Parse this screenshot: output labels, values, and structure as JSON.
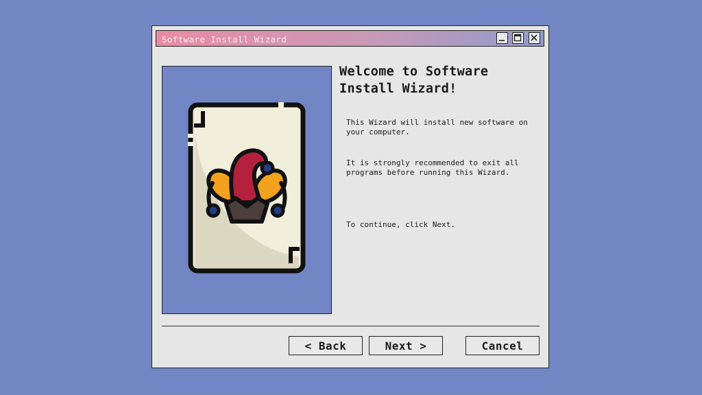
{
  "window": {
    "title": "Software Install Wizard"
  },
  "content": {
    "heading": "Welcome to Software Install Wizard!",
    "paragraphs": [
      "This Wizard will install new software on your computer.",
      "It is strongly recommended to exit all programs before running this Wizard.",
      "To continue, click Next."
    ],
    "illustration_icon": "jester-card-icon"
  },
  "buttons": {
    "back": "< Back",
    "next": "Next >",
    "cancel": "Cancel"
  },
  "colors": {
    "background": "#7286c6",
    "window": "#e6e6e6",
    "titlebar_start": "#ea8aa4",
    "titlebar_end": "#8f9acb",
    "jester_red": "#b5203f",
    "jester_orange": "#f2a21c",
    "jester_blue": "#1f3d8c",
    "card_face": "#f1eedb"
  }
}
